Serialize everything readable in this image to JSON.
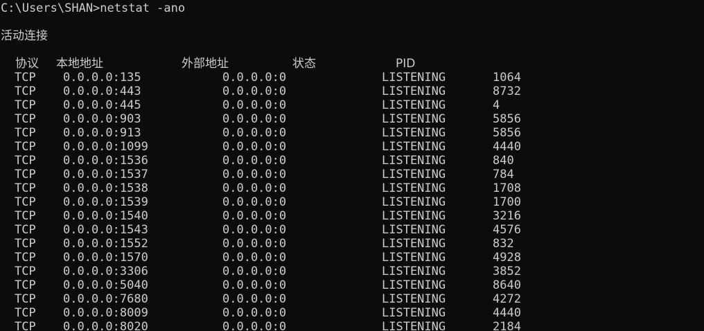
{
  "console": {
    "command_line": "C:\\Users\\SHAN>netstat -ano",
    "section_title": "活动连接",
    "headers": {
      "proto": "协议",
      "local": "本地地址",
      "foreign": "外部地址",
      "state": "状态",
      "pid": "PID"
    },
    "rows": [
      {
        "proto": "TCP",
        "local": "0.0.0.0:135",
        "foreign": "0.0.0.0:0",
        "state": "LISTENING",
        "pid": "1064"
      },
      {
        "proto": "TCP",
        "local": "0.0.0.0:443",
        "foreign": "0.0.0.0:0",
        "state": "LISTENING",
        "pid": "8732"
      },
      {
        "proto": "TCP",
        "local": "0.0.0.0:445",
        "foreign": "0.0.0.0:0",
        "state": "LISTENING",
        "pid": "4"
      },
      {
        "proto": "TCP",
        "local": "0.0.0.0:903",
        "foreign": "0.0.0.0:0",
        "state": "LISTENING",
        "pid": "5856"
      },
      {
        "proto": "TCP",
        "local": "0.0.0.0:913",
        "foreign": "0.0.0.0:0",
        "state": "LISTENING",
        "pid": "5856"
      },
      {
        "proto": "TCP",
        "local": "0.0.0.0:1099",
        "foreign": "0.0.0.0:0",
        "state": "LISTENING",
        "pid": "4440"
      },
      {
        "proto": "TCP",
        "local": "0.0.0.0:1536",
        "foreign": "0.0.0.0:0",
        "state": "LISTENING",
        "pid": "840"
      },
      {
        "proto": "TCP",
        "local": "0.0.0.0:1537",
        "foreign": "0.0.0.0:0",
        "state": "LISTENING",
        "pid": "784"
      },
      {
        "proto": "TCP",
        "local": "0.0.0.0:1538",
        "foreign": "0.0.0.0:0",
        "state": "LISTENING",
        "pid": "1708"
      },
      {
        "proto": "TCP",
        "local": "0.0.0.0:1539",
        "foreign": "0.0.0.0:0",
        "state": "LISTENING",
        "pid": "1700"
      },
      {
        "proto": "TCP",
        "local": "0.0.0.0:1540",
        "foreign": "0.0.0.0:0",
        "state": "LISTENING",
        "pid": "3216"
      },
      {
        "proto": "TCP",
        "local": "0.0.0.0:1543",
        "foreign": "0.0.0.0:0",
        "state": "LISTENING",
        "pid": "4576"
      },
      {
        "proto": "TCP",
        "local": "0.0.0.0:1552",
        "foreign": "0.0.0.0:0",
        "state": "LISTENING",
        "pid": "832"
      },
      {
        "proto": "TCP",
        "local": "0.0.0.0:1570",
        "foreign": "0.0.0.0:0",
        "state": "LISTENING",
        "pid": "4928"
      },
      {
        "proto": "TCP",
        "local": "0.0.0.0:3306",
        "foreign": "0.0.0.0:0",
        "state": "LISTENING",
        "pid": "3852"
      },
      {
        "proto": "TCP",
        "local": "0.0.0.0:5040",
        "foreign": "0.0.0.0:0",
        "state": "LISTENING",
        "pid": "8640"
      },
      {
        "proto": "TCP",
        "local": "0.0.0.0:7680",
        "foreign": "0.0.0.0:0",
        "state": "LISTENING",
        "pid": "4272"
      },
      {
        "proto": "TCP",
        "local": "0.0.0.0:8009",
        "foreign": "0.0.0.0:0",
        "state": "LISTENING",
        "pid": "4440"
      },
      {
        "proto": "TCP",
        "local": "0.0.0.0:8020",
        "foreign": "0.0.0.0:0",
        "state": "LISTENING",
        "pid": "2184"
      }
    ]
  },
  "colors": {
    "background": "#0c0c0c",
    "text": "#cccccc"
  }
}
